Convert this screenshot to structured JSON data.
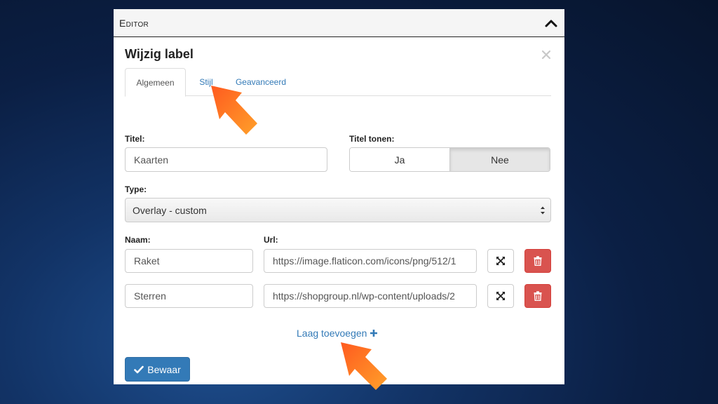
{
  "panel": {
    "title": "Editor"
  },
  "dialog": {
    "title": "Wijzig label"
  },
  "tabs": [
    {
      "label": "Algemeen",
      "active": true
    },
    {
      "label": "Stijl",
      "active": false
    },
    {
      "label": "Geavanceerd",
      "active": false
    }
  ],
  "form": {
    "titel_label": "Titel:",
    "titel_value": "Kaarten",
    "titel_tonen_label": "Titel tonen:",
    "titel_tonen_options": [
      "Ja",
      "Nee"
    ],
    "titel_tonen_selected": "Nee",
    "type_label": "Type:",
    "type_value": "Overlay - custom",
    "naam_label": "Naam:",
    "url_label": "Url:",
    "layers": [
      {
        "naam": "Raket",
        "url": "https://image.flaticon.com/icons/png/512/1"
      },
      {
        "naam": "Sterren",
        "url": "https://shopgroup.nl/wp-content/uploads/2"
      }
    ],
    "add_layer_label": "Laag toevoegen",
    "save_label": "Bewaar"
  },
  "icons": {
    "collapse": "chevron-up-icon",
    "close": "close-icon",
    "expand": "expand-arrows-icon",
    "delete": "trash-icon",
    "add": "plus-icon",
    "save": "checkmark-icon"
  },
  "colors": {
    "primary": "#337ab7",
    "danger": "#d9534f",
    "annotation_arrow": "#f57c1f"
  }
}
